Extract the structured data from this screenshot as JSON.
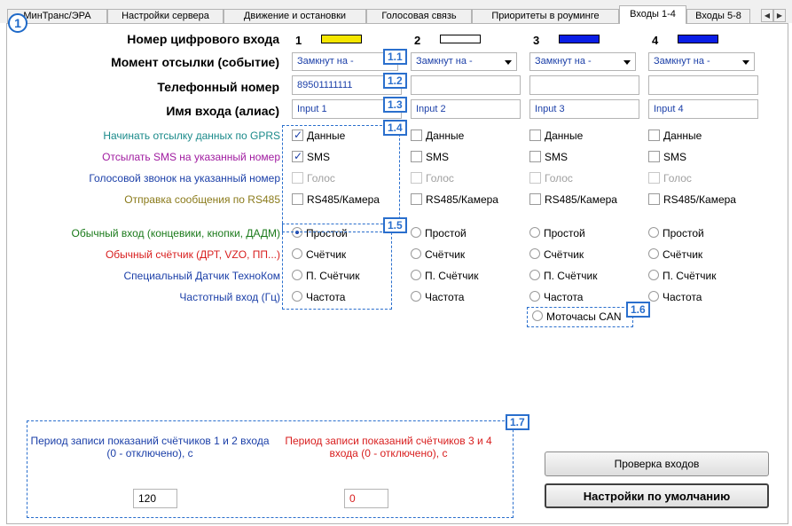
{
  "tabs": [
    {
      "label": "МинТранс/ЭРА",
      "active": false
    },
    {
      "label": "Настройки сервера",
      "active": false
    },
    {
      "label": "Движение и остановки",
      "active": false
    },
    {
      "label": "Голосовая связь",
      "active": false
    },
    {
      "label": "Приоритеты в роуминге",
      "active": false
    },
    {
      "label": "Входы 1-4",
      "active": true
    },
    {
      "label": "Входы 5-8",
      "active": false
    }
  ],
  "section_marker": "1",
  "labels": {
    "input_number": "Номер цифрового входа",
    "send_moment": "Момент отсылки (событие)",
    "phone": "Телефонный номер",
    "alias": "Имя входа (алиас)",
    "gprs": "Начинать отсылку данных по GPRS",
    "sms": "Отсылать SMS на указанный номер",
    "voice": "Голосовой звонок на указанный номер",
    "rs485": "Отправка сообщения по RS485",
    "mode_simple": "Обычный вход (концевики, кнопки, ДАДМ)",
    "mode_counter": "Обычный счётчик (ДРТ, VZO, ПП...)",
    "mode_special": "Специальный Датчик ТехноКом",
    "mode_freq": "Частотный вход (Гц)"
  },
  "label_colors": {
    "gprs": "#1a8a8a",
    "sms": "#a01ca0",
    "voice": "#1b3fa8",
    "rs485": "#8a7a1a",
    "mode_simple": "#1a7a1a",
    "mode_counter": "#d81e1e",
    "mode_special": "#1b3fa8",
    "mode_freq": "#1b3fa8"
  },
  "inputs": [
    {
      "num": "1",
      "color": "#f5e600",
      "event": "Замкнут на -",
      "phone": "89501111111",
      "alias": "Input 1",
      "data": true,
      "sms": true,
      "voice": false,
      "rs485": false,
      "mode": "simple"
    },
    {
      "num": "2",
      "color": "#ffffff",
      "event": "Замкнут на -",
      "phone": "",
      "alias": "Input 2",
      "data": false,
      "sms": false,
      "voice": false,
      "rs485": false,
      "mode": "none"
    },
    {
      "num": "3",
      "color": "#0a1ee6",
      "event": "Замкнут на -",
      "phone": "",
      "alias": "Input 3",
      "data": false,
      "sms": false,
      "voice": false,
      "rs485": false,
      "mode": "none"
    },
    {
      "num": "4",
      "color": "#0a1ee6",
      "event": "Замкнут на -",
      "phone": "",
      "alias": "Input 4",
      "data": false,
      "sms": false,
      "voice": false,
      "rs485": false,
      "mode": "none"
    }
  ],
  "opt_labels": {
    "data": "Данные",
    "sms": "SMS",
    "voice": "Голос",
    "rs485": "RS485/Камера",
    "simple": "Простой",
    "counter": "Счётчик",
    "special": "П. Счётчик",
    "freq": "Частота",
    "motohours": "Моточасы CAN"
  },
  "tags": {
    "t11": "1.1",
    "t12": "1.2",
    "t13": "1.3",
    "t14": "1.4",
    "t15": "1.5",
    "t16": "1.6",
    "t17": "1.7"
  },
  "period": {
    "label_12": "Период записи показаний счётчиков 1 и 2 входа (0 - отключено), с",
    "value_12": "120",
    "label_34": "Период записи показаний счётчиков 3 и 4 входа (0 - отключено), с",
    "value_34": "0"
  },
  "buttons": {
    "check": "Проверка входов",
    "defaults": "Настройки по умолчанию"
  },
  "colors": {
    "accent": "#2a6fcd",
    "period_12": "#1b3fa8",
    "period_34": "#d81e1e"
  }
}
